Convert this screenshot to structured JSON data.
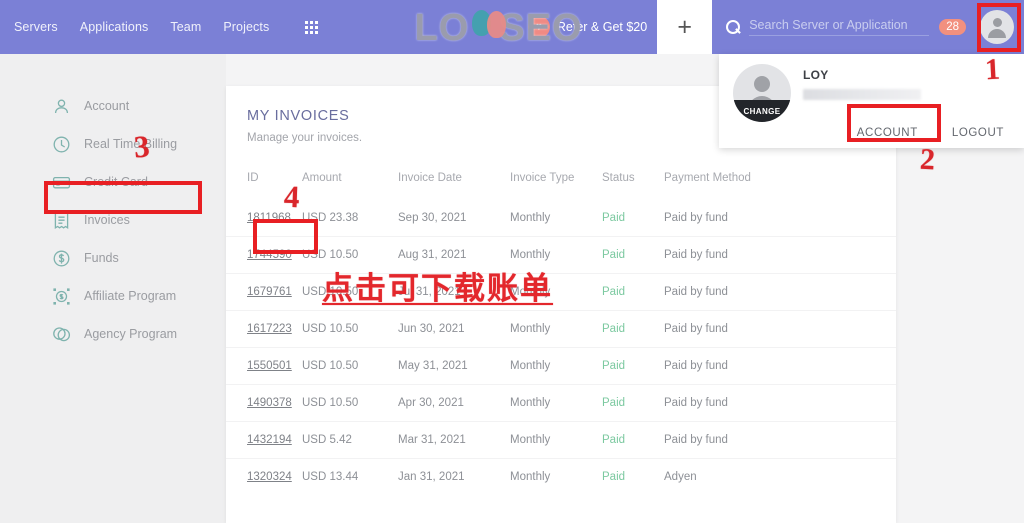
{
  "header": {
    "nav_links": [
      {
        "label": "Servers"
      },
      {
        "label": "Applications"
      },
      {
        "label": "Team"
      },
      {
        "label": "Projects"
      }
    ],
    "grid_icon": "apps-grid-icon",
    "refer_label": "Refer & Get $20",
    "heart_icon": "heart-icon",
    "plus_label": "+",
    "search": {
      "icon": "search-icon",
      "placeholder": "Search Server or Application",
      "value": ""
    },
    "notification_count": "28",
    "avatar_icon": "user-avatar-icon",
    "logo_text": "LO SEO",
    "logo_left": "LO",
    "logo_right": "SEO",
    "colors": {
      "bar": "#7b80d6",
      "badge": "#f2907f",
      "heart": "#f08a84"
    }
  },
  "account_dropdown": {
    "user_name": "LOY",
    "email_masked": "",
    "change_label": "CHANGE",
    "account_label": "ACCOUNT",
    "logout_label": "LOGOUT"
  },
  "sidebar": {
    "items": [
      {
        "label": "Account",
        "icon": "person-icon"
      },
      {
        "label": "Real Time Billing",
        "icon": "clock-icon"
      },
      {
        "label": "Credit Card",
        "icon": "credit-card-icon"
      },
      {
        "label": "Invoices",
        "icon": "invoice-receipt-icon"
      },
      {
        "label": "Funds",
        "icon": "dollar-coin-icon"
      },
      {
        "label": "Affiliate Program",
        "icon": "affiliate-coin-icon"
      },
      {
        "label": "Agency Program",
        "icon": "handshake-icon"
      }
    ]
  },
  "main": {
    "title": "MY INVOICES",
    "subtitle": "Manage your invoices.",
    "columns": [
      "ID",
      "Amount",
      "Invoice Date",
      "Invoice Type",
      "Status",
      "Payment Method"
    ],
    "rows": [
      {
        "id": "1811968",
        "amount": "USD 23.38",
        "date": "Sep 30, 2021",
        "type": "Monthly",
        "status": "Paid",
        "payment": "Paid by fund"
      },
      {
        "id": "1744590",
        "amount": "USD 10.50",
        "date": "Aug 31, 2021",
        "type": "Monthly",
        "status": "Paid",
        "payment": "Paid by fund"
      },
      {
        "id": "1679761",
        "amount": "USD 10.50",
        "date": "Jul 31, 2021",
        "type": "Monthly",
        "status": "Paid",
        "payment": "Paid by fund"
      },
      {
        "id": "1617223",
        "amount": "USD 10.50",
        "date": "Jun 30, 2021",
        "type": "Monthly",
        "status": "Paid",
        "payment": "Paid by fund"
      },
      {
        "id": "1550501",
        "amount": "USD 10.50",
        "date": "May 31, 2021",
        "type": "Monthly",
        "status": "Paid",
        "payment": "Paid by fund"
      },
      {
        "id": "1490378",
        "amount": "USD 10.50",
        "date": "Apr 30, 2021",
        "type": "Monthly",
        "status": "Paid",
        "payment": "Paid by fund"
      },
      {
        "id": "1432194",
        "amount": "USD 5.42",
        "date": "Mar 31, 2021",
        "type": "Monthly",
        "status": "Paid",
        "payment": "Paid by fund"
      },
      {
        "id": "1320324",
        "amount": "USD 13.44",
        "date": "Jan 31, 2021",
        "type": "Monthly",
        "status": "Paid",
        "payment": "Adyen"
      }
    ],
    "status_color": "#7cc9a0"
  },
  "annotations": {
    "marker_1": "1",
    "marker_2": "2",
    "marker_3": "3",
    "marker_4": "4",
    "chinese_note": "点击可下载账单",
    "color": "#e3272c"
  }
}
